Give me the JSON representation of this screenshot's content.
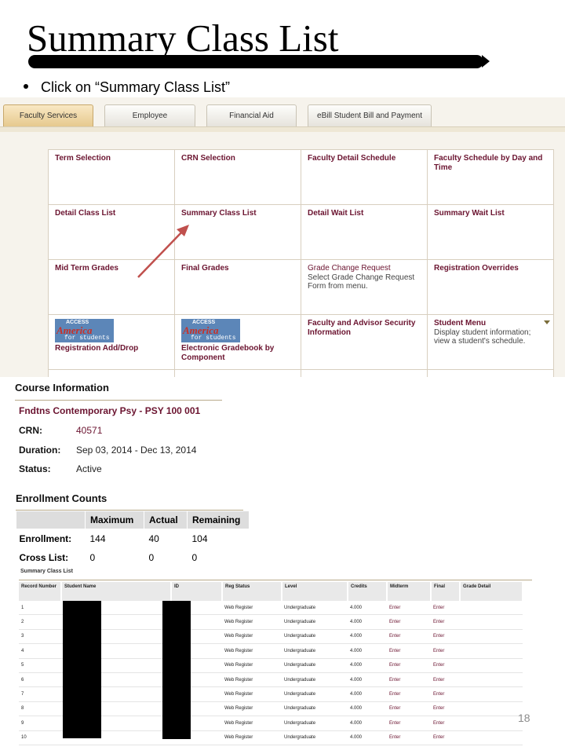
{
  "slide": {
    "title": "Summary Class List",
    "bullet": "Click on “Summary Class List”",
    "page_number": "18"
  },
  "tabs": [
    {
      "label": "Faculty Services",
      "active": true
    },
    {
      "label": "Employee",
      "active": false
    },
    {
      "label": "Financial Aid",
      "active": false
    },
    {
      "label": "eBill Student Bill and Payment",
      "active": false
    }
  ],
  "menu": {
    "term_selection": "Term Selection",
    "crn_selection": "CRN Selection",
    "faculty_detail_schedule": "Faculty Detail Schedule",
    "faculty_schedule_day_time": "Faculty Schedule by Day and Time",
    "detail_class_list": "Detail Class List",
    "summary_class_list": "Summary Class List",
    "detail_wait_list": "Detail Wait List",
    "summary_wait_list": "Summary Wait List",
    "mid_term_grades": "Mid Term Grades",
    "final_grades": "Final Grades",
    "grade_change_request": "Grade Change Request",
    "grade_change_desc": "Select Grade Change Request Form from menu.",
    "registration_overrides": "Registration Overrides",
    "registration_add_drop": "Registration Add/Drop",
    "electronic_gradebook": "Electronic Gradebook by Component",
    "faculty_advisor_security": "Faculty and Advisor Security Information",
    "student_menu": "Student Menu",
    "student_menu_desc": "Display student information; view a student's schedule.",
    "logo_top": "ACCESS",
    "logo_mid": "America",
    "logo_bottom": "for students"
  },
  "course_info": {
    "heading": "Course Information",
    "course_title": "Fndtns Contemporary Psy - PSY 100 001",
    "crn_label": "CRN:",
    "crn_value": "40571",
    "duration_label": "Duration:",
    "duration_value": "Sep 03, 2014 - Dec 13, 2014",
    "status_label": "Status:",
    "status_value": "Active"
  },
  "enrollment_counts": {
    "heading": "Enrollment Counts",
    "headers": [
      "Maximum",
      "Actual",
      "Remaining"
    ],
    "rows": [
      {
        "label": "Enrollment:",
        "values": [
          "144",
          "40",
          "104"
        ]
      },
      {
        "label": "Cross List:",
        "values": [
          "0",
          "0",
          "0"
        ]
      }
    ]
  },
  "summary_class_list": {
    "title": "Summary Class List",
    "headers": [
      "Record Number",
      "Student Name",
      "ID",
      "Reg Status",
      "Level",
      "Credits",
      "Midterm",
      "Final",
      "Grade Detail"
    ],
    "rows": [
      [
        "1",
        "",
        "",
        "Web Register",
        "Undergraduate",
        "4.000",
        "Enter",
        "Enter",
        ""
      ],
      [
        "2",
        "",
        "",
        "Web Register",
        "Undergraduate",
        "4.000",
        "Enter",
        "Enter",
        ""
      ],
      [
        "3",
        "",
        "",
        "Web Register",
        "Undergraduate",
        "4.000",
        "Enter",
        "Enter",
        ""
      ],
      [
        "4",
        "",
        "",
        "Web Register",
        "Undergraduate",
        "4.000",
        "Enter",
        "Enter",
        ""
      ],
      [
        "5",
        "",
        "",
        "Web Register",
        "Undergraduate",
        "4.000",
        "Enter",
        "Enter",
        ""
      ],
      [
        "6",
        "",
        "",
        "Web Register",
        "Undergraduate",
        "4.000",
        "Enter",
        "Enter",
        ""
      ],
      [
        "7",
        "",
        "",
        "Web Register",
        "Undergraduate",
        "4.000",
        "Enter",
        "Enter",
        ""
      ],
      [
        "8",
        "",
        "",
        "Web Register",
        "Undergraduate",
        "4.000",
        "Enter",
        "Enter",
        ""
      ],
      [
        "9",
        "",
        "",
        "Web Register",
        "Undergraduate",
        "4.000",
        "Enter",
        "Enter",
        ""
      ],
      [
        "10",
        "",
        "",
        "Web Register",
        "Undergraduate",
        "4.000",
        "Enter",
        "Enter",
        ""
      ]
    ]
  },
  "colors": {
    "link": "#6b1430",
    "annotation_arrow": "#c0504d",
    "active_tab": "#e6c98e"
  }
}
